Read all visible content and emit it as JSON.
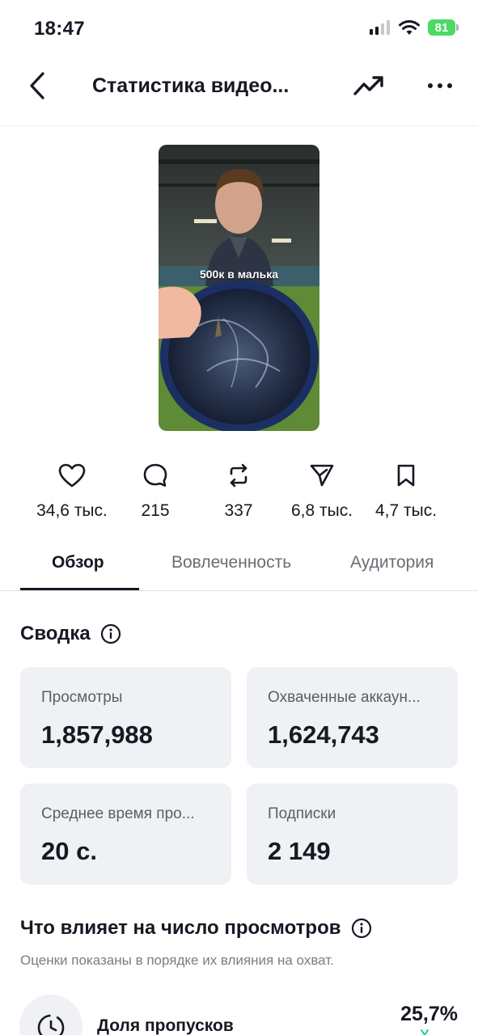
{
  "status_bar": {
    "time": "18:47",
    "battery": "81"
  },
  "nav": {
    "title": "Статистика видео..."
  },
  "video": {
    "caption": "500к в малька"
  },
  "stats": [
    {
      "icon": "heart-icon",
      "value": "34,6 тыс."
    },
    {
      "icon": "comment-icon",
      "value": "215"
    },
    {
      "icon": "repost-icon",
      "value": "337"
    },
    {
      "icon": "share-icon",
      "value": "6,8 тыс."
    },
    {
      "icon": "bookmark-icon",
      "value": "4,7 тыс."
    }
  ],
  "tabs": [
    {
      "label": "Обзор",
      "active": true
    },
    {
      "label": "Вовлеченность",
      "active": false
    },
    {
      "label": "Аудитория",
      "active": false
    }
  ],
  "summary": {
    "title": "Сводка",
    "cards": [
      {
        "label": "Просмотры",
        "value": "1,857,988"
      },
      {
        "label": "Охваченные аккаун...",
        "value": "1,624,743"
      },
      {
        "label": "Среднее время про...",
        "value": "20 с."
      },
      {
        "label": "Подписки",
        "value": "2 149"
      }
    ]
  },
  "influence": {
    "title": "Что влияет на число просмотров",
    "subtitle": "Оценки показаны в порядке их влияния на охват.",
    "factors": [
      {
        "label": "Доля пропусков",
        "value": "25,7%",
        "trend_color": "#20c997"
      }
    ]
  },
  "colors": {
    "text": "#161823",
    "card_bg": "#eff1f4",
    "muted": "#6b6d75",
    "battery": "#4cd964"
  }
}
